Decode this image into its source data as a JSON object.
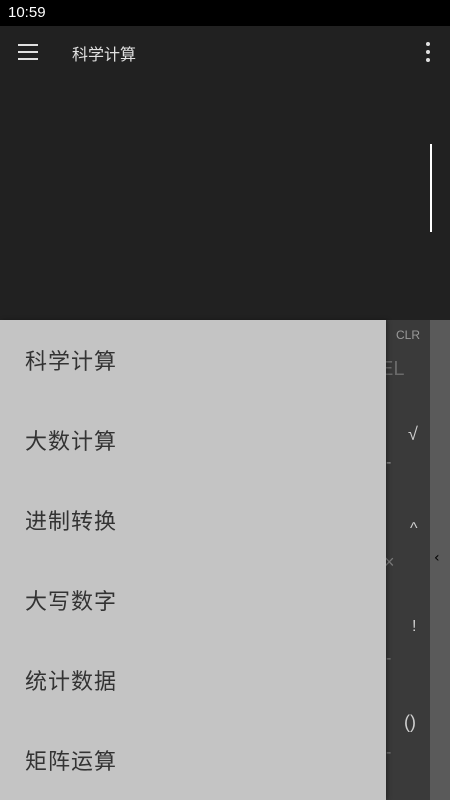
{
  "status_bar": {
    "time": "10:59"
  },
  "toolbar": {
    "title": "科学计算",
    "menu_icon": "hamburger-menu-icon",
    "more_icon": "more-vert-icon"
  },
  "keypad": {
    "clr": "CLR",
    "del": "EL",
    "sqrt": "√",
    "minus": "-",
    "power": "^",
    "times": "×",
    "factorial": "!",
    "minus2": "-",
    "parens": "()",
    "minus3": "-",
    "side_arrow": "‹"
  },
  "drawer": {
    "items": [
      {
        "label": "科学计算"
      },
      {
        "label": "大数计算"
      },
      {
        "label": "进制转换"
      },
      {
        "label": "大写数字"
      },
      {
        "label": "统计数据"
      },
      {
        "label": "矩阵运算"
      }
    ]
  },
  "colors": {
    "background": "#212121",
    "drawer": "#c4c4c4",
    "drawer_text": "#333333"
  }
}
